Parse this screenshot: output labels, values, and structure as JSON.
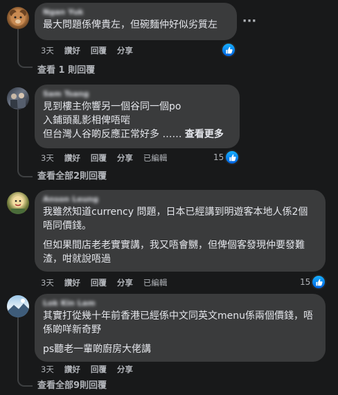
{
  "comments": [
    {
      "author": "Ngan Yuk",
      "lines": [
        "最大問題係俾貴左，但碗麵仲好似劣質左"
      ],
      "time": "3天",
      "like_label": "讚好",
      "reply_label": "回覆",
      "share_label": "分享",
      "edited_label": "",
      "reaction_count": "",
      "view_replies": "查看 1 則回覆"
    },
    {
      "author": "Sam Tsang",
      "lines": [
        "見到樓主你響另一個谷同一個po\n入鋪頭亂影相俾唔啱\n但台灣人谷啲反應正常好多 ……"
      ],
      "see_more": "查看更多",
      "time": "3天",
      "like_label": "讚好",
      "reply_label": "回覆",
      "share_label": "分享",
      "edited_label": "已編輯",
      "reaction_count": "15",
      "view_replies": "查看全部2則回覆"
    },
    {
      "author": "Anson Leung",
      "lines": [
        "我雖然知道currency 問題，日本已經講到明遊客本地人係2個唔同價錢。",
        "但如果間店老老實實講，我又唔會嬲，但俾個客發現仲要發難渣，咁就說唔過"
      ],
      "time": "3天",
      "like_label": "讚好",
      "reply_label": "回覆",
      "share_label": "分享",
      "edited_label": "已編輯",
      "reaction_count": "15",
      "view_replies": ""
    },
    {
      "author": "Lok Kin Lam",
      "lines": [
        "其實打從幾十年前香港已經係中文同英文menu係兩個價錢，唔係啲咩新奇野",
        "ps聽老一輩啲廚房大佬講"
      ],
      "time": "3天",
      "like_label": "讚好",
      "reply_label": "回覆",
      "share_label": "分享",
      "edited_label": "",
      "reaction_count": "",
      "view_replies": "查看全部9則回覆"
    }
  ],
  "colors": {
    "background": "#18191a",
    "bubble": "#3a3b3c",
    "text": "#e4e6eb",
    "muted": "#b0b3b8",
    "like_blue": "#0571ed"
  },
  "icons": {
    "more": "more-horizontal-icon",
    "like": "thumbs-up-icon"
  },
  "more_glyph": "···"
}
